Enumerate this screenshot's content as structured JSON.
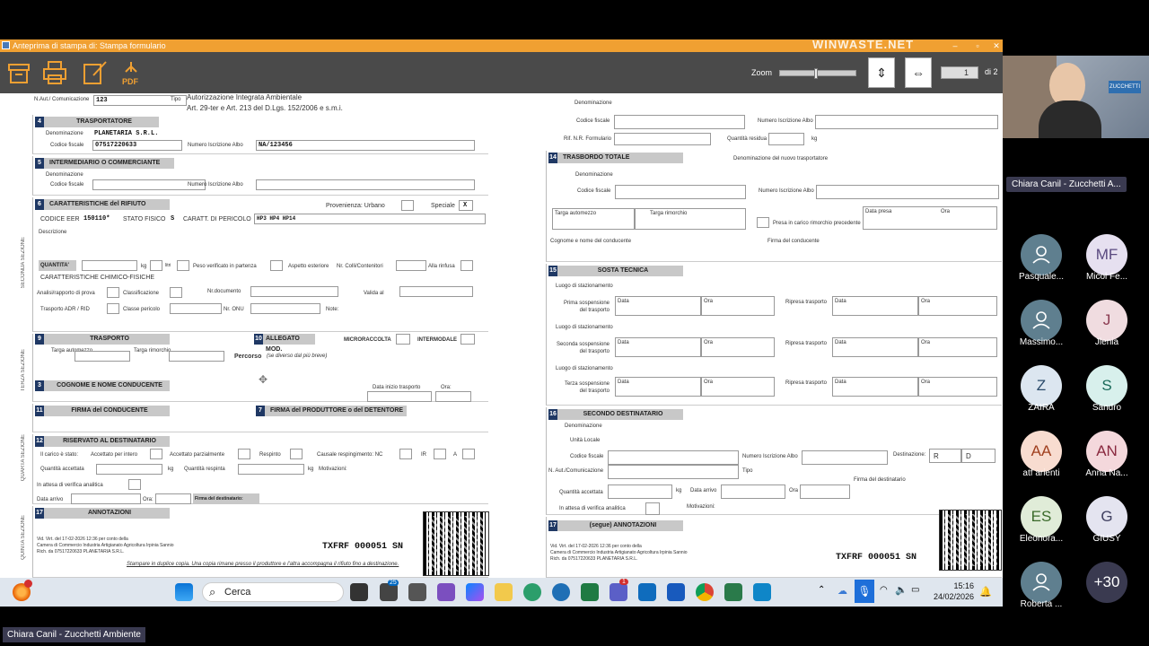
{
  "window": {
    "title": "Anteprima di stampa di: Stampa formulario",
    "brand": "WINWASTE.NET"
  },
  "toolbar": {
    "zoom_label": "Zoom",
    "page_value": "1",
    "page_of": "di 2",
    "pdf_label": "PDF"
  },
  "left_page": {
    "top": {
      "n_aut_label": "N.Aut./ Comunicazione",
      "n_aut_value": "123",
      "tipo_label": "Tipo",
      "tipo_value": "Autorizzazione Integrata Ambientale",
      "tipo_ref": "Art. 29-ter e Art. 213 del D.Lgs. 152/2006 e s.m.i."
    },
    "s4": {
      "num": "4",
      "title": "TRASPORTATORE",
      "den_label": "Denominazione",
      "den_value": "PLANETARIA S.R.L.",
      "cf_label": "Codice fiscale",
      "cf_value": "07517220633",
      "albo_label": "Numero Iscrizione Albo",
      "albo_value": "NA/123456"
    },
    "s5": {
      "num": "5",
      "title": "INTERMEDIARIO O COMMERCIANTE",
      "den_label": "Denominazione",
      "cf_label": "Codice fiscale",
      "albo_label": "Numero Iscrizione Albo"
    },
    "s6": {
      "num": "6",
      "title": "CARATTERISTICHE del RIFIUTO",
      "provenienza": "Provenienza: Urbano",
      "speciale": "Speciale",
      "speciale_mark": "X",
      "eer_label": "CODICE EER",
      "eer_value": "150110*",
      "stato_label": "STATO FISICO",
      "stato_value": "S",
      "pericolo_label": "CARATT. DI PERICOLO",
      "pericolo_value": "HP3 HP4 HP14",
      "descr": "Descrizione",
      "quantita": "QUANTITA'",
      "kg": "kg",
      "lt": "litri",
      "peso": "Peso verificato in partenza",
      "aspetto": "Aspetto esteriore",
      "colli": "Nr. Colli/Contenitori",
      "rinfusa": "Alla rinfusa",
      "chim": "CARATTERISTICHE CHIMICO-FISICHE",
      "analisi": "Analisi/rapporto di prova",
      "classif": "Classificazione",
      "nrdoc": "Nr.documento",
      "valida": "Valida al",
      "adr": "Trasporto ADR / RID",
      "classe": "Classe pericolo",
      "onu": "Nr. ONU",
      "note": "Note:"
    },
    "seconda_sezione": "SECONDA SEZIONE",
    "s9": {
      "num": "9",
      "title": "TRASPORTO",
      "targa_auto": "Targa automezzo",
      "targa_rim": "Targa rimorchio",
      "percorso": "Percorso",
      "percorso_note": "(se diverso dal più breve)"
    },
    "s10": {
      "num": "10",
      "title": "ALLEGATO MOD.",
      "micro": "MICRORACCOLTA",
      "inter": "INTERMODALE"
    },
    "terza_sezione": "TERZA SEZIONE",
    "s3": {
      "num": "3",
      "title": "COGNOME E NOME CONDUCENTE",
      "data_inizio": "Data inizio trasporto",
      "ora": "Ora:"
    },
    "s11": {
      "num": "11",
      "title": "FIRMA del CONDUCENTE"
    },
    "s7": {
      "num": "7",
      "title": "FIRMA del PRODUTTORE o del DETENTORE"
    },
    "s12": {
      "num": "12",
      "title": "RISERVATO AL DESTINATARIO",
      "carico": "Il carico è stato:",
      "acc_int": "Accettato per intero",
      "acc_parz": "Accettato parzialmente",
      "respinto": "Respinto",
      "causale": "Causale respingimento: NC",
      "ir": "IR",
      "a": "A",
      "q_acc": "Quantità accettata",
      "kg": "kg",
      "q_resp": "Quantità respinta",
      "motiv": "Motivazioni:",
      "attesa": "In attesa di verifica analitica",
      "data_arrivo": "Data arrivo",
      "ora": "Ora:",
      "firma_dest": "Firma del destinatario:"
    },
    "quarta_sezione": "QUARTA SEZIONE",
    "s17": {
      "num": "17",
      "title": "ANNOTAZIONI",
      "quinta": "QUINTA SEZIONE"
    },
    "footer": {
      "vid": "Vid. Virt. del 17-02-2026 12:36 per conto della",
      "camera": "Camera di Commercio Industria Artigianato Agricoltura Irpinia Sannio",
      "rich": "Rich. da 07517220633 PLANETARIA S.R.L.",
      "code": "TXFRF 000051 SN",
      "stampare": "Stampare in duplice copia. Una copia rimane presso il produttore e l'altra accompagna il rifiuto fino a destinazione."
    }
  },
  "right_page": {
    "top": {
      "den_label": "Denominazione",
      "cf_label": "Codice fiscale",
      "albo_label": "Numero Iscrizione Albo",
      "rif_label": "Rif. N.R. Formulario",
      "residua_label": "Quantità residua",
      "kg": "kg"
    },
    "s14": {
      "num": "14",
      "title": "TRASBORDO TOTALE",
      "nuovo": "Denominazione del nuovo trasportatore",
      "den_label": "Denominazione",
      "cf_label": "Codice fiscale",
      "albo_label": "Numero Iscrizione Albo",
      "targa_auto": "Targa automezzo",
      "targa_rim": "Targa rimorchio",
      "presa": "Presa in carico rimorchio precedente",
      "data_presa": "Data presa",
      "ora": "Ora",
      "cognome": "Cognome e nome del conducente",
      "firma": "Firma del conducente"
    },
    "s15": {
      "num": "15",
      "title": "SOSTA TECNICA",
      "luogo": "Luogo di stazionamento",
      "prima": "Prima sospensione del trasporto",
      "seconda": "Seconda sospensione del trasporto",
      "terza": "Terza sospensione del trasporto",
      "ripresa": "Ripresa trasporto",
      "data": "Data",
      "ora": "Ora"
    },
    "s16": {
      "num": "16",
      "title": "SECONDO DESTINATARIO",
      "den_label": "Denominazione",
      "unita": "Unità Locale",
      "cf_label": "Codice fiscale",
      "albo_label": "Numero Iscrizione Albo",
      "dest_label": "Destinazione:",
      "dest_r": "R",
      "dest_d": "D",
      "naut": "N. Aut./Comunicazione",
      "tipo": "Tipo",
      "firma_dest": "Firma del destinatario",
      "q_acc": "Quantità accettata",
      "kg": "kg",
      "data_arrivo": "Data arrivo",
      "ora": "Ora",
      "attesa": "In attesa di verifica analitica",
      "motivazioni": "Motivazioni:"
    },
    "s17": {
      "num": "17",
      "title": "(segue) ANNOTAZIONI"
    },
    "footer": {
      "vid": "Vid. Virt. del 17-02-2026 12:36 per conto della",
      "camera": "Camera di Commercio Industria Artigianato Agricoltura Irpinia Sannio",
      "rich": "Rich. da 07517220633 PLANETARIA S.R.L.",
      "code": "TXFRF 000051 SN"
    }
  },
  "taskbar": {
    "search": "Cerca",
    "time": "15:16",
    "date": "24/02/2026",
    "mail_badge": "25",
    "teams_badge": "1"
  },
  "meeting": {
    "speaker_pill": "Chiara Canil - Zucchetti A...",
    "bottom_pill": "Chiara Canil - Zucchetti Ambiente",
    "participants": [
      {
        "initials": "",
        "name": "Pasquale...",
        "color": "#5f7f8f",
        "fg": "#fff",
        "icon": "person-icon"
      },
      {
        "initials": "MF",
        "name": "Micol Fe...",
        "color": "#e6e0f0",
        "fg": "#5a4a80"
      },
      {
        "initials": "",
        "name": "Massimo...",
        "color": "#5f7f8f",
        "fg": "#fff",
        "icon": "person-icon"
      },
      {
        "initials": "J",
        "name": "Jlenia",
        "color": "#f0dce0",
        "fg": "#8a3a50"
      },
      {
        "initials": "Z",
        "name": "ZAIRA",
        "color": "#dce6f0",
        "fg": "#2a4a6a"
      },
      {
        "initials": "S",
        "name": "Sandro",
        "color": "#d8f0ec",
        "fg": "#1a6a5a"
      },
      {
        "initials": "AA",
        "name": "atf arienti",
        "color": "#f8dcd0",
        "fg": "#a04020"
      },
      {
        "initials": "AN",
        "name": "Anna Na...",
        "color": "#f4d8dc",
        "fg": "#8a2a40"
      },
      {
        "initials": "ES",
        "name": "Eleonora...",
        "color": "#e0ecd8",
        "fg": "#3a6a2a"
      },
      {
        "initials": "G",
        "name": "GIUSY",
        "color": "#e4e4f0",
        "fg": "#404060"
      },
      {
        "initials": "",
        "name": "Roberta ...",
        "color": "#5f7f8f",
        "fg": "#fff",
        "icon": "person-icon"
      },
      {
        "initials": "+30",
        "name": "",
        "color": "#3a3a50",
        "fg": "#fff"
      }
    ]
  },
  "colors": {
    "accent": "#f0a032",
    "navy": "#1f3864",
    "toolbar": "#4a4a4a"
  }
}
